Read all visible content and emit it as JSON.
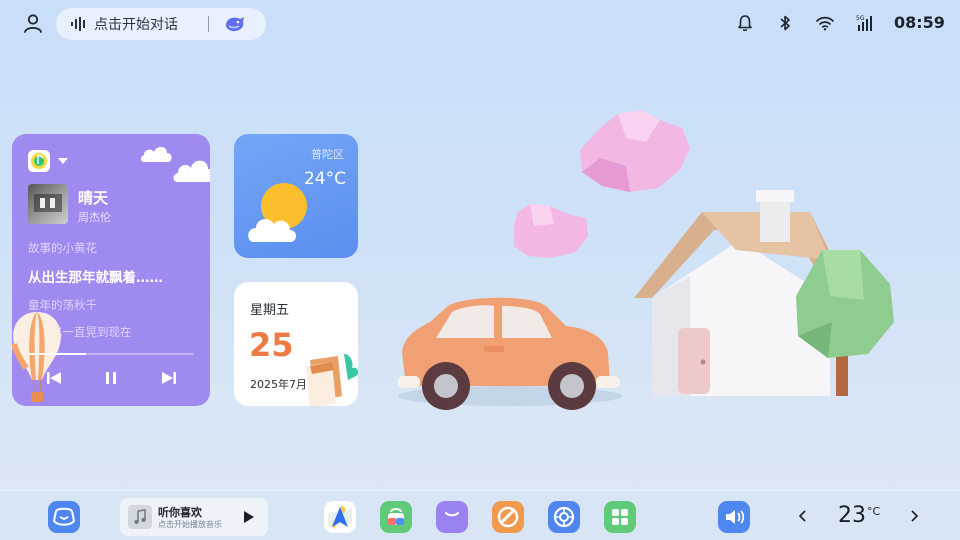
{
  "topbar": {
    "voice_placeholder": "点击开始对话",
    "clock": "08:59"
  },
  "music": {
    "title": "晴天",
    "artist": "周杰伦",
    "lyrics": [
      "故事的小黄花",
      "从出生那年就飘着……",
      "童年的荡秋千",
      "随记忆一直晃到现在"
    ],
    "progress": 0.35
  },
  "weather": {
    "location": "普陀区",
    "temperature": "24°C",
    "icon": "partly-cloudy-icon"
  },
  "date": {
    "weekday": "星期五",
    "day": "25",
    "month": "2025年7月"
  },
  "dock": {
    "player_title": "听你喜欢",
    "player_subtitle": "点击开始播放音乐",
    "cabin_temp": "23",
    "cabin_unit": "°C"
  },
  "colors": {
    "music_card": "#a08af0",
    "weather_card": "#5b8ef0",
    "date_accent": "#ec7b43"
  }
}
